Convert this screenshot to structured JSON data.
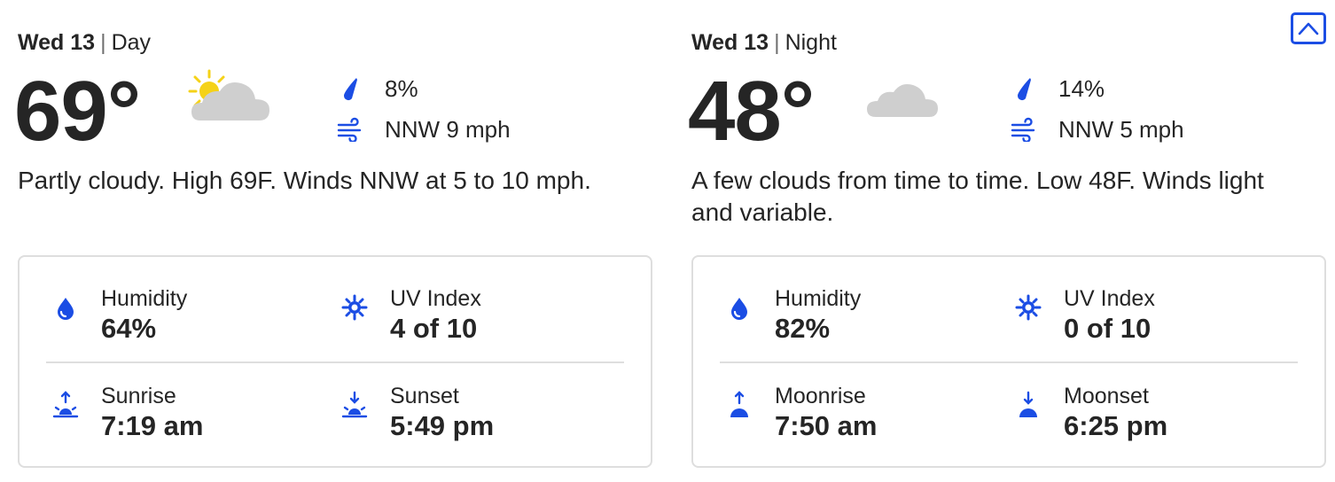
{
  "colors": {
    "accent": "#1b4de4",
    "text": "#252525",
    "border": "#dedede",
    "sun": "#f5d218",
    "cloud": "#cfcfcf",
    "moon": "#e2e2e2"
  },
  "collapse_button": {
    "icon": "chevron-up-icon"
  },
  "day": {
    "date_label": "Wed 13",
    "period": "Day",
    "temperature": "69°",
    "condition_icon": "partly-cloudy-day-icon",
    "precip": {
      "icon": "raindrop-icon",
      "value": "8%"
    },
    "wind": {
      "icon": "wind-icon",
      "value": "NNW 9 mph"
    },
    "narrative": "Partly cloudy. High 69F. Winds NNW at 5 to 10 mph.",
    "details": {
      "humidity": {
        "icon": "humidity-icon",
        "label": "Humidity",
        "value": "64%"
      },
      "uv": {
        "icon": "uv-index-icon",
        "label": "UV Index",
        "value": "4 of 10"
      },
      "rise": {
        "icon": "sunrise-icon",
        "label": "Sunrise",
        "value": "7:19 am"
      },
      "set": {
        "icon": "sunset-icon",
        "label": "Sunset",
        "value": "5:49 pm"
      }
    }
  },
  "night": {
    "date_label": "Wed 13",
    "period": "Night",
    "temperature": "48°",
    "condition_icon": "partly-cloudy-night-icon",
    "precip": {
      "icon": "raindrop-icon",
      "value": "14%"
    },
    "wind": {
      "icon": "wind-icon",
      "value": "NNW 5 mph"
    },
    "narrative": "A few clouds from time to time. Low 48F. Winds light and variable.",
    "details": {
      "humidity": {
        "icon": "humidity-icon",
        "label": "Humidity",
        "value": "82%"
      },
      "uv": {
        "icon": "uv-index-icon",
        "label": "UV Index",
        "value": "0 of 10"
      },
      "rise": {
        "icon": "moonrise-icon",
        "label": "Moonrise",
        "value": "7:50 am"
      },
      "set": {
        "icon": "moonset-icon",
        "label": "Moonset",
        "value": "6:25 pm"
      }
    }
  }
}
